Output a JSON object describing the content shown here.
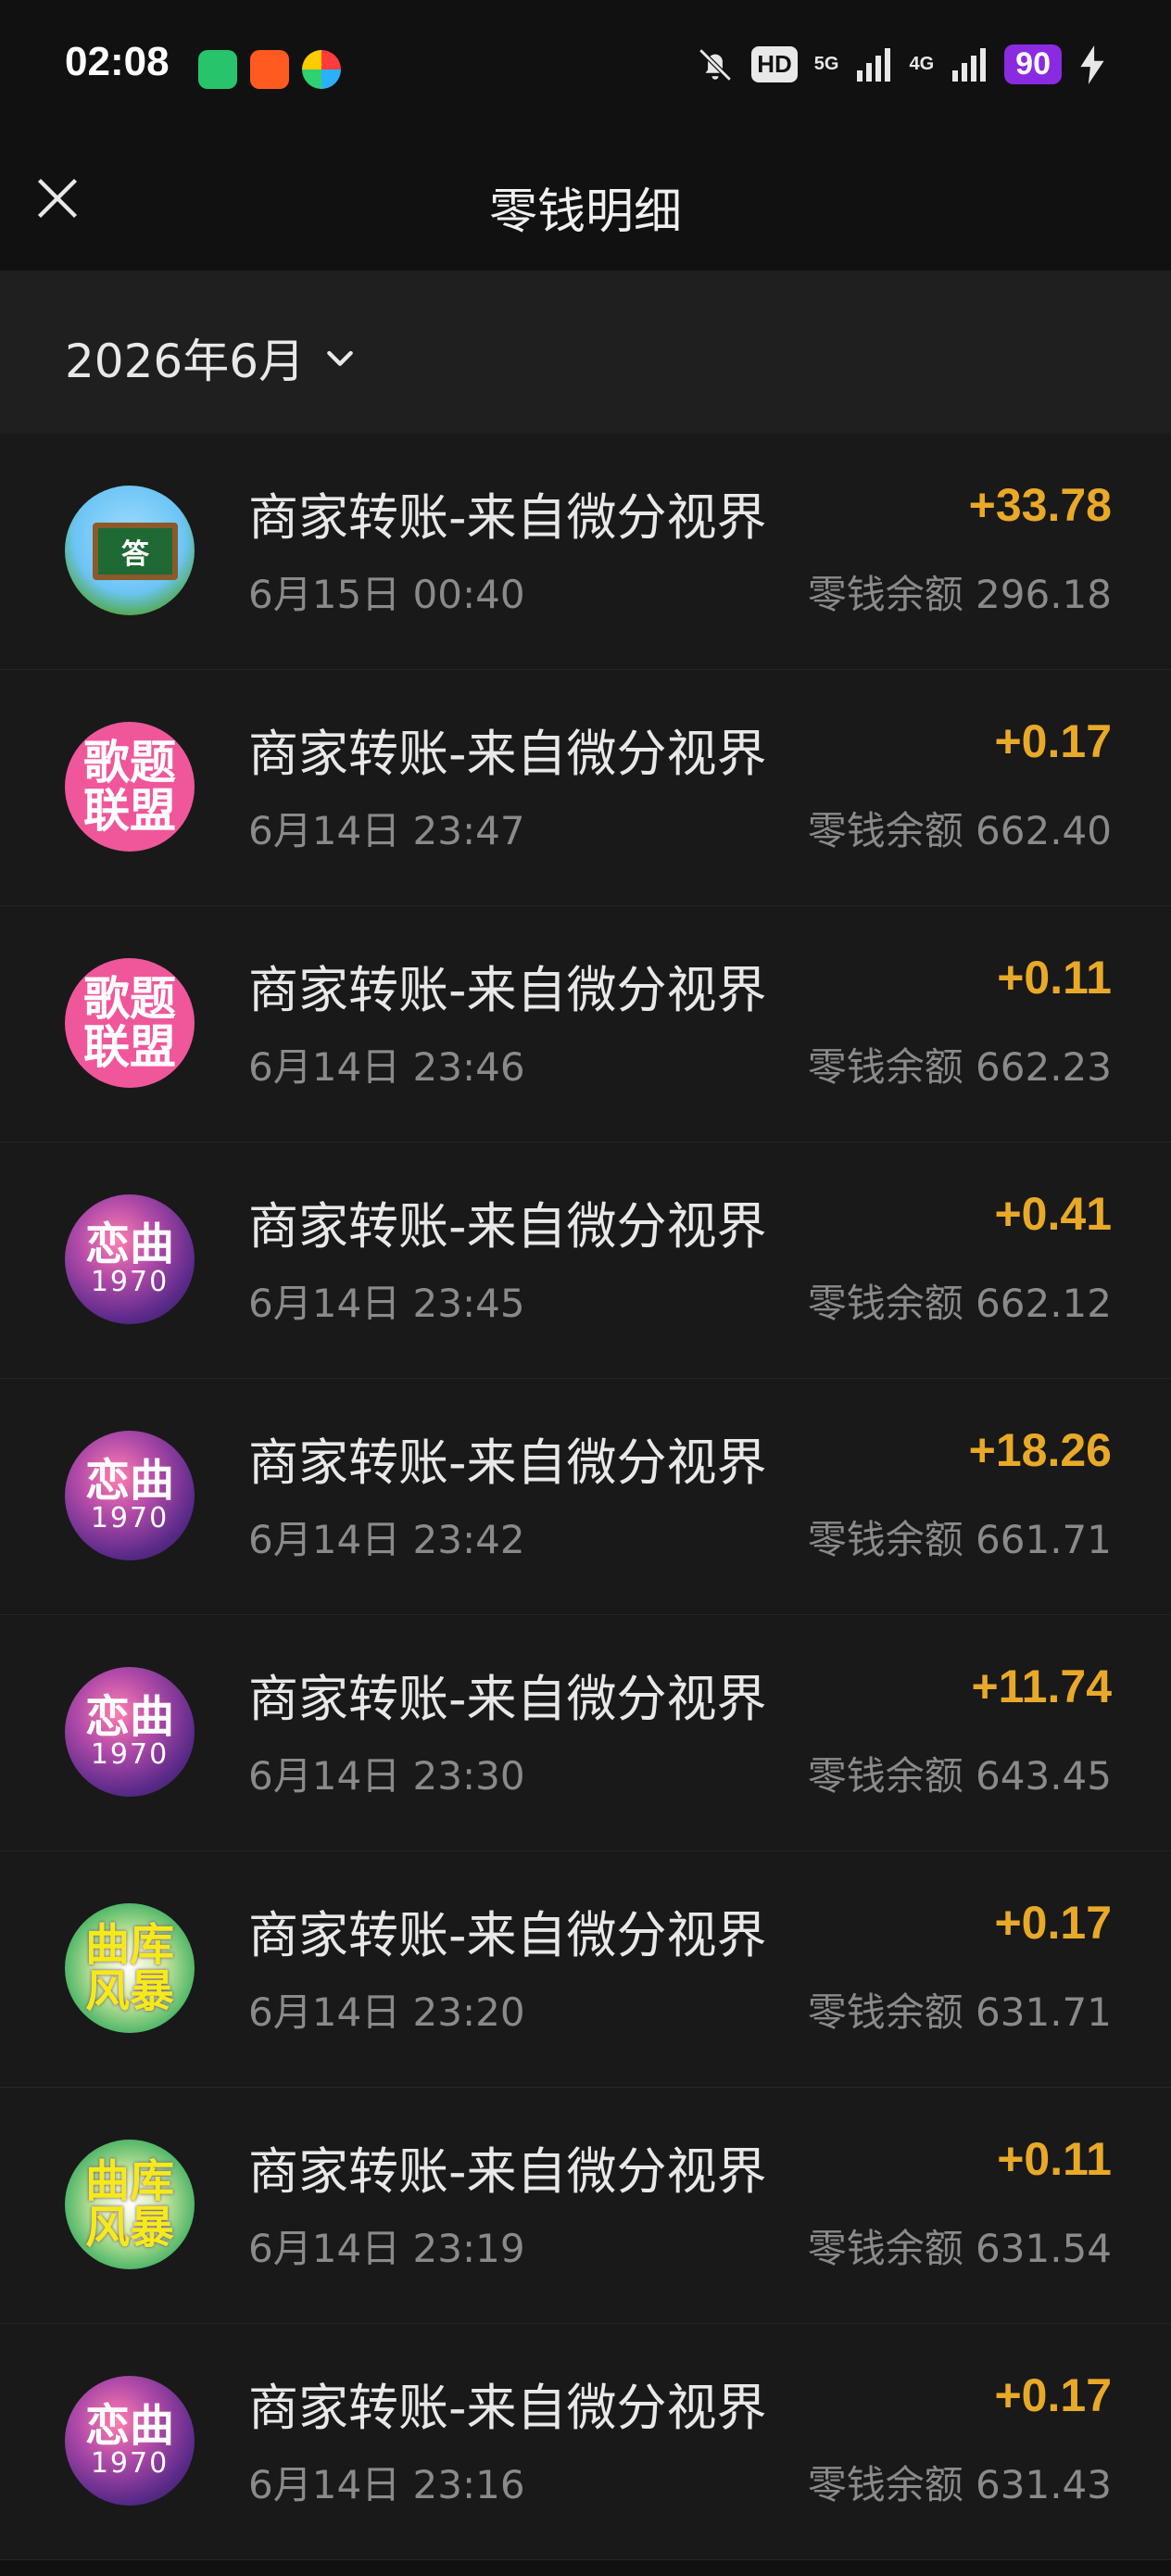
{
  "status_bar": {
    "time": "02:08",
    "hd": "HD",
    "signal_5g": "5G",
    "signal_4g": "4G",
    "battery": "90"
  },
  "header": {
    "title": "零钱明细"
  },
  "filter": {
    "month": "2026年6月"
  },
  "transactions": [
    {
      "title": "商家转账-来自微分视界",
      "time": "6月15日 00:40",
      "amount": "+33.78",
      "balance": "零钱余额 296.18",
      "avatar": "school",
      "avatar_text": [
        "答"
      ]
    },
    {
      "title": "商家转账-来自微分视界",
      "time": "6月14日 23:47",
      "amount": "+0.17",
      "balance": "零钱余额 662.40",
      "avatar": "pink",
      "avatar_text": [
        "歌题",
        "联盟"
      ]
    },
    {
      "title": "商家转账-来自微分视界",
      "time": "6月14日 23:46",
      "amount": "+0.11",
      "balance": "零钱余额 662.23",
      "avatar": "pink",
      "avatar_text": [
        "歌题",
        "联盟"
      ]
    },
    {
      "title": "商家转账-来自微分视界",
      "time": "6月14日 23:45",
      "amount": "+0.41",
      "balance": "零钱余额 662.12",
      "avatar": "love",
      "avatar_text": [
        "恋曲",
        "1970"
      ]
    },
    {
      "title": "商家转账-来自微分视界",
      "time": "6月14日 23:42",
      "amount": "+18.26",
      "balance": "零钱余额 661.71",
      "avatar": "love",
      "avatar_text": [
        "恋曲",
        "1970"
      ]
    },
    {
      "title": "商家转账-来自微分视界",
      "time": "6月14日 23:30",
      "amount": "+11.74",
      "balance": "零钱余额 643.45",
      "avatar": "love",
      "avatar_text": [
        "恋曲",
        "1970"
      ]
    },
    {
      "title": "商家转账-来自微分视界",
      "time": "6月14日 23:20",
      "amount": "+0.17",
      "balance": "零钱余额 631.71",
      "avatar": "storm",
      "avatar_text": [
        "曲库",
        "风暴"
      ]
    },
    {
      "title": "商家转账-来自微分视界",
      "time": "6月14日 23:19",
      "amount": "+0.11",
      "balance": "零钱余额 631.54",
      "avatar": "storm",
      "avatar_text": [
        "曲库",
        "风暴"
      ]
    },
    {
      "title": "商家转账-来自微分视界",
      "time": "6月14日 23:16",
      "amount": "+0.17",
      "balance": "零钱余额 631.43",
      "avatar": "love",
      "avatar_text": [
        "恋曲",
        "1970"
      ]
    }
  ],
  "colors": {
    "amount": "#e9a928",
    "background": "#191919",
    "header_background": "#111111",
    "filter_background": "#1f1f1f",
    "battery": "#8a2be2"
  },
  "icons": {
    "close": "close-icon",
    "chevron": "chevron-down-icon",
    "mute": "bell-off-icon",
    "charging": "bolt-icon"
  }
}
